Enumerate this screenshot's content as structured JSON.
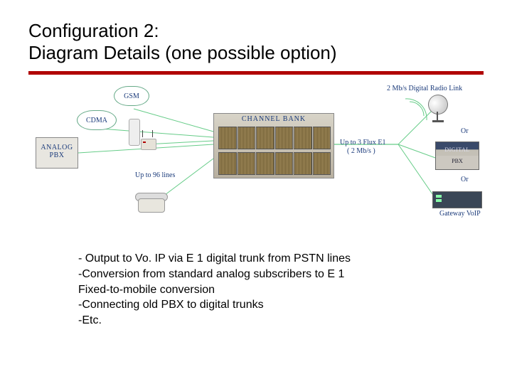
{
  "title_line1": "Configuration 2:",
  "title_line2": "Diagram Details (one possible option)",
  "diagram": {
    "gsm": "GSM",
    "cdma": "CDMA",
    "analog_pbx_1": "ANALOG",
    "analog_pbx_2": "PBX",
    "lines_label": "Up to 96 lines",
    "channel_bank": "CHANNEL BANK",
    "flux_label_1": "Up to 3 Flux E1",
    "flux_label_2": "( 2 Mb/s )",
    "radio_link": "2 Mb/s Digital Radio Link",
    "or1": "Or",
    "digital_pbx_1": "DIGITAL",
    "digital_pbx_2": "PBX",
    "or2": "Or",
    "gateway": "Gateway VoIP"
  },
  "bullets": {
    "b1": "- Output to Vo. IP via E 1 digital trunk from PSTN lines",
    "b2": "-Conversion from standard analog subscribers to E 1",
    "b3": "Fixed-to-mobile conversion",
    "b4": "-Connecting old PBX to digital trunks",
    "b5": "-Etc."
  }
}
